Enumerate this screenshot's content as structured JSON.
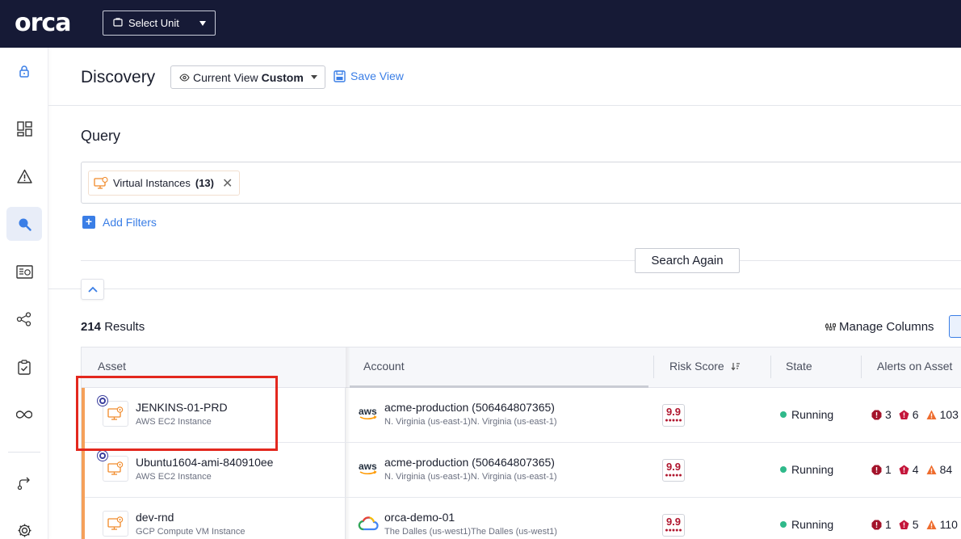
{
  "topbar": {
    "logo_text": "orca",
    "unit_select_label": "Select Unit"
  },
  "sidebar": {
    "items": [
      {
        "name": "lock-icon"
      },
      {
        "name": "dashboard-icon"
      },
      {
        "name": "alert-icon"
      },
      {
        "name": "search-icon",
        "active": true
      },
      {
        "name": "inventory-icon"
      },
      {
        "name": "graph-icon"
      },
      {
        "name": "compliance-icon"
      },
      {
        "name": "infinity-icon"
      },
      {
        "name": "shift-left-icon"
      },
      {
        "name": "settings-icon"
      }
    ]
  },
  "header": {
    "title": "Discovery",
    "view_prefix": "Current View",
    "view_value": "Custom",
    "save_view": "Save View"
  },
  "query": {
    "title": "Query",
    "chip_label": "Virtual Instances",
    "chip_count": "(13)",
    "add_filters": "Add Filters",
    "search_again": "Search Again"
  },
  "results": {
    "count": "214",
    "label": "Results",
    "manage_columns": "Manage Columns"
  },
  "table": {
    "columns": [
      "Asset",
      "Account",
      "Risk Score",
      "State",
      "Alerts on Asset"
    ],
    "rows": [
      {
        "asset_name": "JENKINS-01-PRD",
        "asset_type": "AWS EC2 Instance",
        "provider": "aws",
        "account": "acme-production (506464807365)",
        "region": "N. Virginia  (us-east-1)N. Virginia (us-east-1)",
        "risk": "9.9",
        "state": "Running",
        "alerts": {
          "critical": "3",
          "high": "6",
          "medium": "103"
        }
      },
      {
        "asset_name": "Ubuntu1604-ami-840910ee",
        "asset_type": "AWS EC2 Instance",
        "provider": "aws",
        "account": "acme-production (506464807365)",
        "region": "N. Virginia  (us-east-1)N. Virginia (us-east-1)",
        "risk": "9.9",
        "state": "Running",
        "alerts": {
          "critical": "1",
          "high": "4",
          "medium": "84"
        }
      },
      {
        "asset_name": "dev-rnd",
        "asset_type": "GCP Compute VM Instance",
        "provider": "gcp",
        "account": "orca-demo-01",
        "region": "The Dalles  (us-west1)The Dalles (us-west1)",
        "risk": "9.9",
        "state": "Running",
        "alerts": {
          "critical": "1",
          "high": "5",
          "medium": "110"
        }
      }
    ]
  },
  "colors": {
    "topbar": "#161a36",
    "accent_blue": "#3a7ee6",
    "risk_red": "#b0172f",
    "running_green": "#2fb98a",
    "row_accent": "#f5a05a",
    "highlight": "#e3281e"
  }
}
